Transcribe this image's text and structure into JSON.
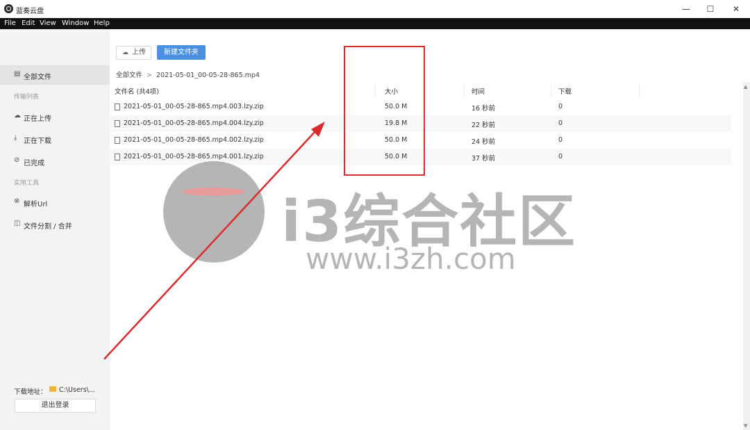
{
  "window": {
    "title": "蓝奏云盘",
    "controls": {
      "minimize": "—",
      "maximize": "☐",
      "close": "✕"
    }
  },
  "menubar": [
    "File",
    "Edit",
    "View",
    "Window",
    "Help"
  ],
  "sidebar": {
    "items": [
      {
        "label": "全部文件",
        "icon": "file-list-icon",
        "active": true
      },
      {
        "label": "正在上传",
        "icon": "cloud-upload-icon"
      },
      {
        "label": "正在下载",
        "icon": "download-icon"
      },
      {
        "label": "已完成",
        "icon": "check-circle-icon"
      },
      {
        "label": "解析Url",
        "icon": "link-icon"
      },
      {
        "label": "文件分割 / 合并",
        "icon": "split-icon"
      }
    ],
    "sections": {
      "transfer": "传输列表",
      "tools": "实用工具"
    },
    "download_label": "下载地址：",
    "download_path": "C:\\Users\\...",
    "logout": "退出登录"
  },
  "toolbar": {
    "upload": "上传",
    "new_folder": "新建文件夹"
  },
  "breadcrumb": {
    "root": "全部文件",
    "separator": ">",
    "current": "2021-05-01_00-05-28-865.mp4"
  },
  "table": {
    "headers": {
      "name": "文件名 (共4项)",
      "size": "大小",
      "time": "时间",
      "downloads": "下载"
    },
    "rows": [
      {
        "name": "2021-05-01_00-05-28-865.mp4.003.lzy.zip",
        "size": "50.0 M",
        "time": "16 秒前",
        "downloads": "0"
      },
      {
        "name": "2021-05-01_00-05-28-865.mp4.004.lzy.zip",
        "size": "19.8 M",
        "time": "22 秒前",
        "downloads": "0"
      },
      {
        "name": "2021-05-01_00-05-28-865.mp4.002.lzy.zip",
        "size": "50.0 M",
        "time": "24 秒前",
        "downloads": "0"
      },
      {
        "name": "2021-05-01_00-05-28-865.mp4.001.lzy.zip",
        "size": "50.0 M",
        "time": "37 秒前",
        "downloads": "0"
      }
    ]
  },
  "watermark": {
    "title": "i3综合社区",
    "url": "www.i3zh.com"
  },
  "annotation_color": "#d92c2c",
  "accent": "#4a90e2"
}
